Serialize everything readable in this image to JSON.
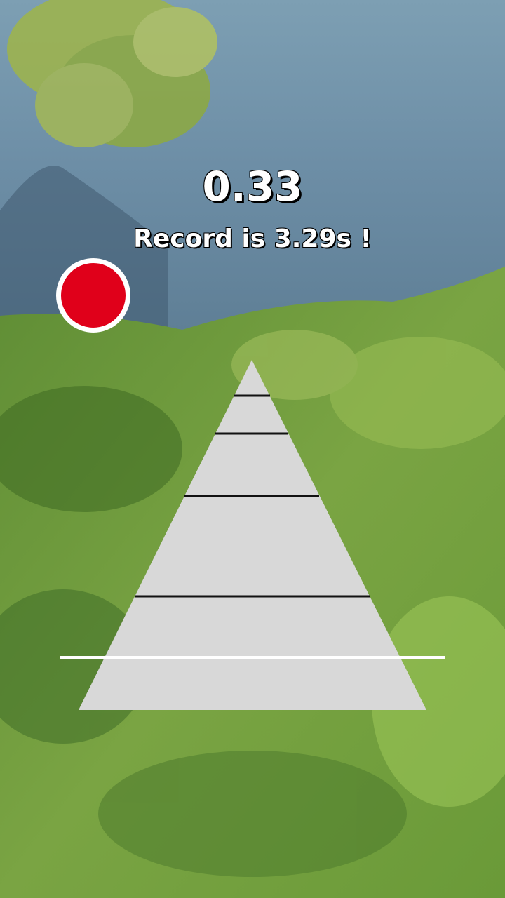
{
  "game": {
    "timer": "0.33",
    "record_text": "Record is 3.29s !"
  },
  "colors": {
    "record_button": "#e0001a",
    "pyramid": "#d8d8d8"
  }
}
